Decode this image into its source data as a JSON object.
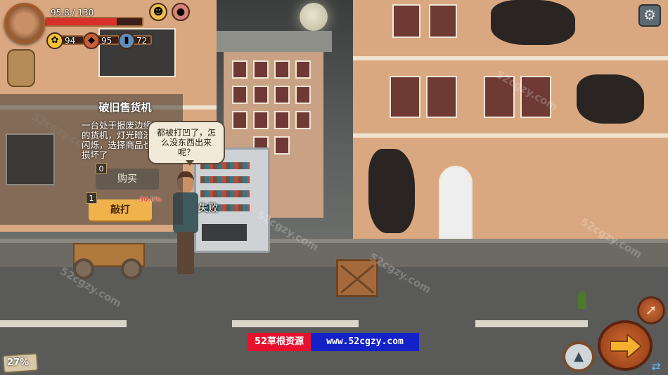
{
  "hud": {
    "health_text": "95.8 / 130",
    "health_fraction": 0.737,
    "food_value": "94",
    "water_value": "95",
    "energy_value": "72",
    "food_icon": "food-icon",
    "water_icon": "meat-icon",
    "energy_icon": "bottle-icon",
    "status_icons": [
      "hunger-status-icon",
      "meat-status-icon"
    ],
    "settings_icon": "gear-icon"
  },
  "dialog": {
    "title": "破旧售货机",
    "description": "一台处于报废边缘的货机，灯光暗淡闪烁，选择商品也损坏了",
    "buy": {
      "label": "购买",
      "cost": "0"
    },
    "hit": {
      "label": "敲打",
      "cost": "1",
      "chance": "30.8%"
    }
  },
  "speech": {
    "text": "都被打凹了，怎么没东西出来呢？"
  },
  "result": {
    "fail_text": "失败"
  },
  "bottom": {
    "percent": "27%",
    "banner_left": "52草根资源",
    "banner_right": "www.52cgzy.com"
  },
  "watermark": "52cgzy.com",
  "colors": {
    "health": "#d8302a",
    "hit_button": "#f0b24b",
    "next_button": "#d16a2f",
    "banner_red": "#e8112d",
    "banner_blue": "#1421c8"
  }
}
